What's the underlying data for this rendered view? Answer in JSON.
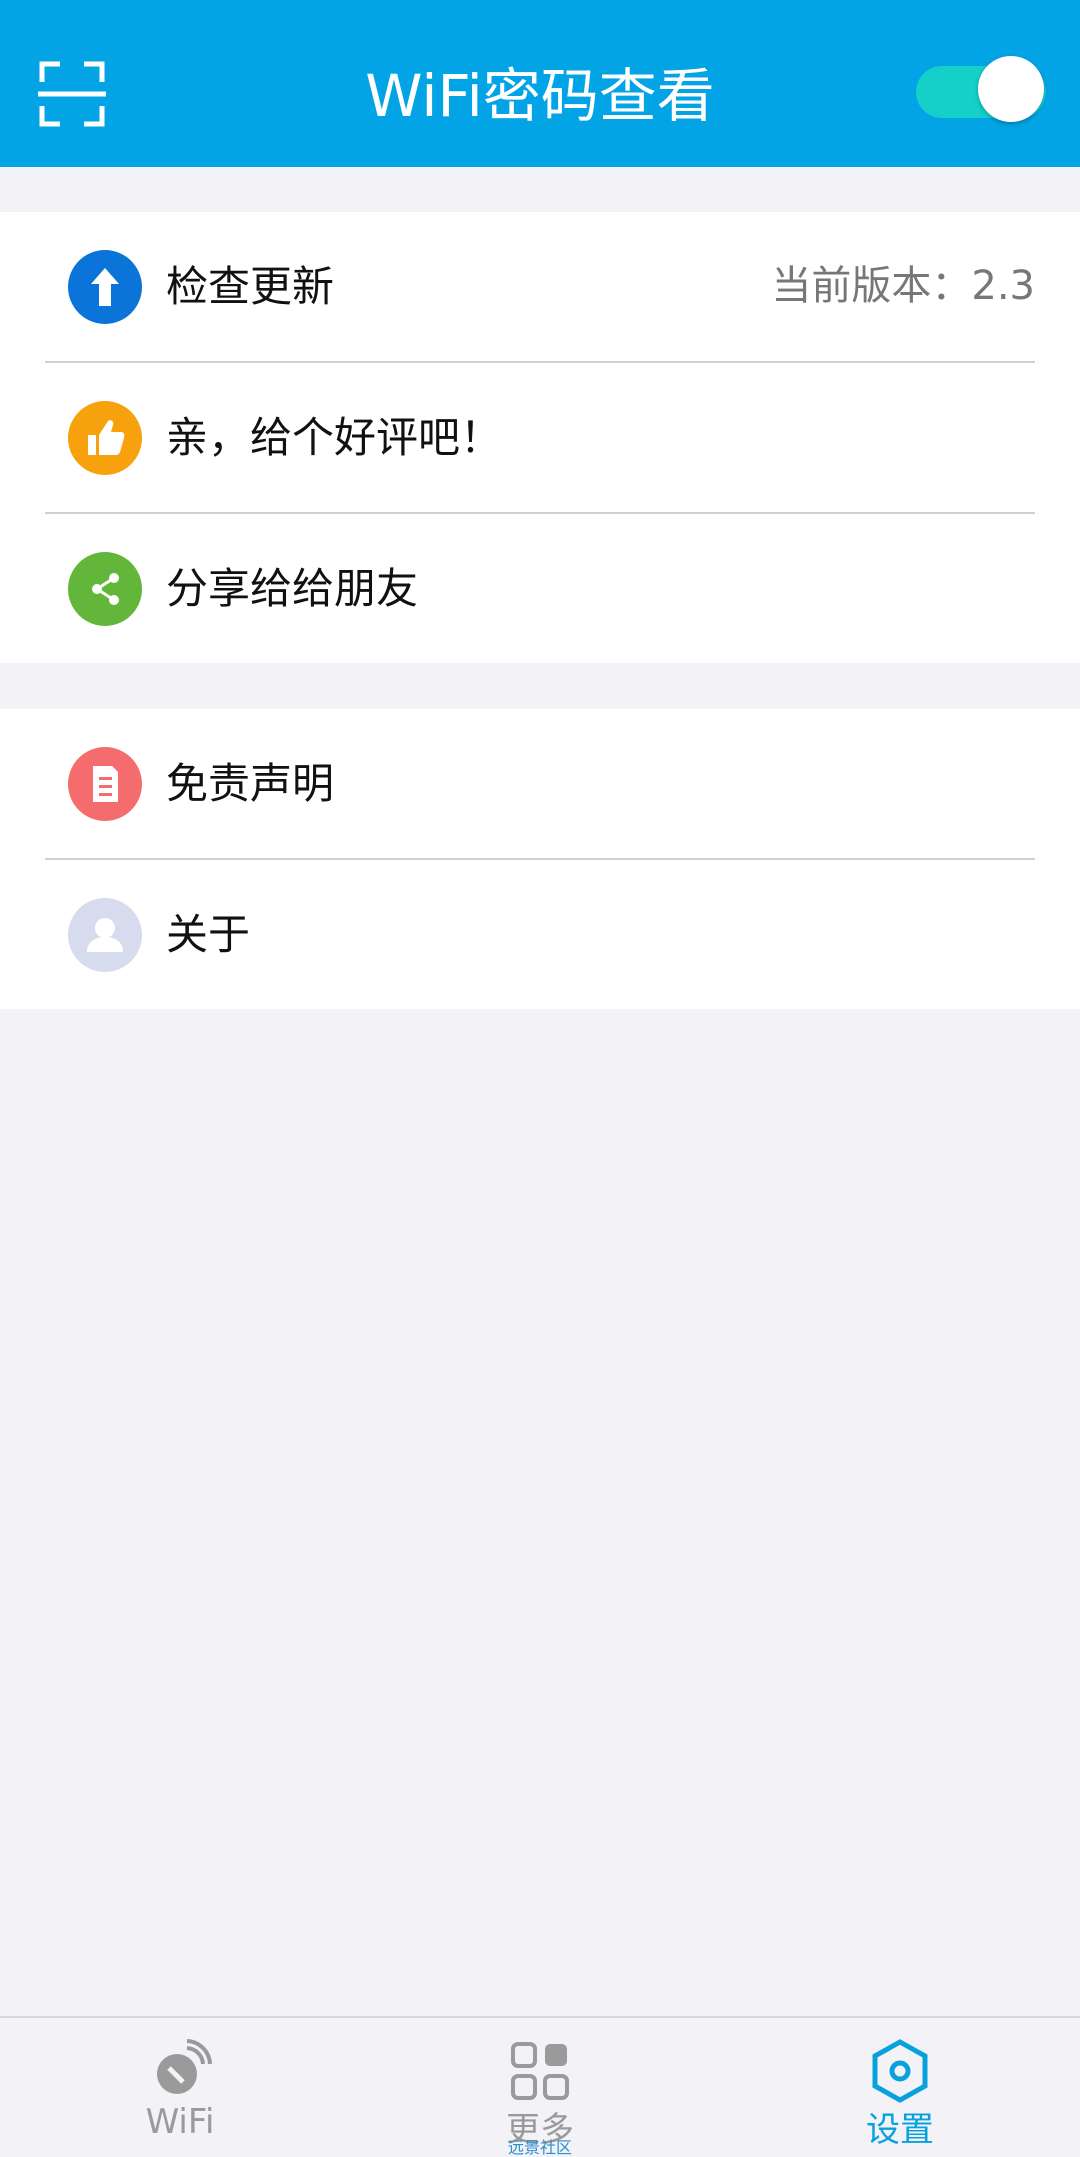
{
  "header": {
    "title": "WiFi密码查看",
    "scan_icon": "scan-frame-icon",
    "toggle_on": true,
    "accent": "#03a4e5"
  },
  "settings": {
    "group1": [
      {
        "label": "检查更新",
        "value": "当前版本：2.3",
        "icon": "arrow-up-icon",
        "color": "#0b74d9"
      },
      {
        "label": "亲，给个好评吧！",
        "icon": "thumbs-up-icon",
        "color": "#f7a10c"
      },
      {
        "label": "分享给给朋友",
        "icon": "share-icon",
        "color": "#62b73a"
      }
    ],
    "group2": [
      {
        "label": "免责声明",
        "icon": "document-icon",
        "color": "#f46c6d"
      },
      {
        "label": "关于",
        "icon": "user-icon",
        "color": "#d6dbed"
      }
    ]
  },
  "bottom_nav": {
    "items": [
      {
        "label": "WiFi",
        "icon": "wifi-satellite-icon",
        "active": false
      },
      {
        "label": "更多",
        "icon": "grid-icon",
        "active": false,
        "overlay": "远景社区"
      },
      {
        "label": "设置",
        "icon": "settings-hexagon-icon",
        "active": true
      }
    ],
    "active_color": "#09a1dd",
    "inactive_color": "#9a9a9a"
  }
}
